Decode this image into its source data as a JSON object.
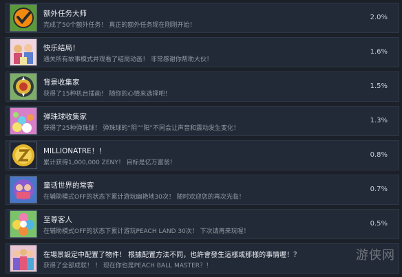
{
  "achievements": [
    {
      "title": "额外任务大师",
      "description": "完成了50个额外任务！ 真正的额外任务现在刚刚开始！",
      "percent": "2.0%",
      "icon": "orange-checkmark-icon"
    },
    {
      "title": "快乐结局！",
      "description": "通关所有故事模式并观看了结局动画！ 非常感谢你帮助大伙！",
      "percent": "1.6%",
      "icon": "characters-group-icon"
    },
    {
      "title": "背景收集家",
      "description": "获得了15种机台插画！ 随你的心情来选择吧！",
      "percent": "1.5%",
      "icon": "badge-emblem-icon"
    },
    {
      "title": "弹珠球收集家",
      "description": "获得了25种弹珠球！ 弹珠球的“阴”“阳”不同会让声音和震动发生变化！",
      "percent": "1.3%",
      "icon": "pinball-balls-icon"
    },
    {
      "title": "MILLIONATRE！！",
      "description": "累计获得1,000,000 ZENY！ 目标是亿万富翁！",
      "percent": "0.8%",
      "icon": "gold-coin-icon"
    },
    {
      "title": "童话世界的常客",
      "description": "在辅助模式OFF的状态下累计游玩幽艳地30次！ 随时欢迎您的再次光临！",
      "percent": "0.7%",
      "icon": "fairytale-characters-icon"
    },
    {
      "title": "至尊客人",
      "description": "在辅助模式OFF的状态下累计游玩PEACH LAND 30次！ 下次请再来玩喔！",
      "percent": "0.5%",
      "icon": "peach-land-flower-icon"
    },
    {
      "title": "在場景設定中配置了物件！ 根據配置方法不同，也許會發生這樣或那樣的事情喔！？",
      "description": "获得了全部成就！ ！ 现在你也是PEACH BALL MASTER？！",
      "percent": "",
      "icon": "all-characters-icon"
    }
  ],
  "watermark": "游侠网"
}
